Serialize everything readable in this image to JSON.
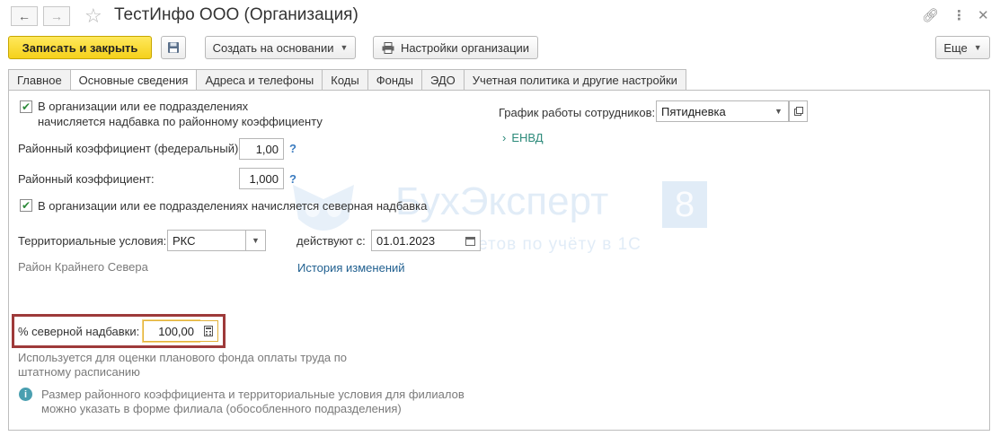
{
  "window": {
    "title": "ТестИнфо ООО (Организация)",
    "back_icon": "arrow-left-icon",
    "forward_icon": "arrow-right-icon",
    "favorite_icon": "star-icon",
    "link_icon": "link-icon",
    "menu_icon": "more-vertical-icon",
    "close_icon": "close-icon"
  },
  "toolbar": {
    "save_close_label": "Записать и закрыть",
    "save_icon": "floppy-disk-icon",
    "create_based_label": "Создать на основании",
    "settings_label": "Настройки организации",
    "more_label": "Еще"
  },
  "tabs": [
    {
      "label": "Главное"
    },
    {
      "label": "Основные сведения",
      "active": true
    },
    {
      "label": "Адреса и телефоны"
    },
    {
      "label": "Коды"
    },
    {
      "label": "Фонды"
    },
    {
      "label": "ЭДО"
    },
    {
      "label": "Учетная политика и другие настройки"
    }
  ],
  "form": {
    "regional_checkbox_label_1": "В организации или ее подразделениях",
    "regional_checkbox_label_2": "начисляется надбавка по районному коэффициенту",
    "regional_checked": true,
    "coef_federal_label": "Районный коэффициент (федеральный):",
    "coef_federal_value": "1,00",
    "coef_label": "Районный коэффициент:",
    "coef_value": "1,000",
    "help_mark": "?",
    "north_checkbox_label": "В организации или ее подразделениях начисляется северная надбавка",
    "north_checked": true,
    "territorial_label": "Территориальные условия:",
    "territorial_value": "РКС",
    "effective_label": "действуют с:",
    "effective_value": "01.01.2023",
    "territory_description": "Район Крайнего Севера",
    "history_link": "История изменений",
    "north_percent_label": "% северной надбавки:",
    "north_percent_value": "100,00",
    "north_percent_note_1": "Используется для оценки планового фонда оплаты труда по",
    "north_percent_note_2": "штатному расписанию",
    "info_text_1": "Размер районного коэффициента и территориальные условия для филиалов",
    "info_text_2": "можно указать в форме филиала (обособленного подразделения)",
    "schedule_label": "График работы сотрудников:",
    "schedule_value": "Пятидневка",
    "envd_label": "ЕНВД"
  },
  "watermark": {
    "brand": "БухЭксперт",
    "badge": "8",
    "tagline": "база ответов по учёту в 1С"
  },
  "colors": {
    "primary_button": "#f5d11a",
    "highlight_frame": "#9e3a3a",
    "link": "#1f5f8f",
    "check": "#2d8a3a"
  }
}
